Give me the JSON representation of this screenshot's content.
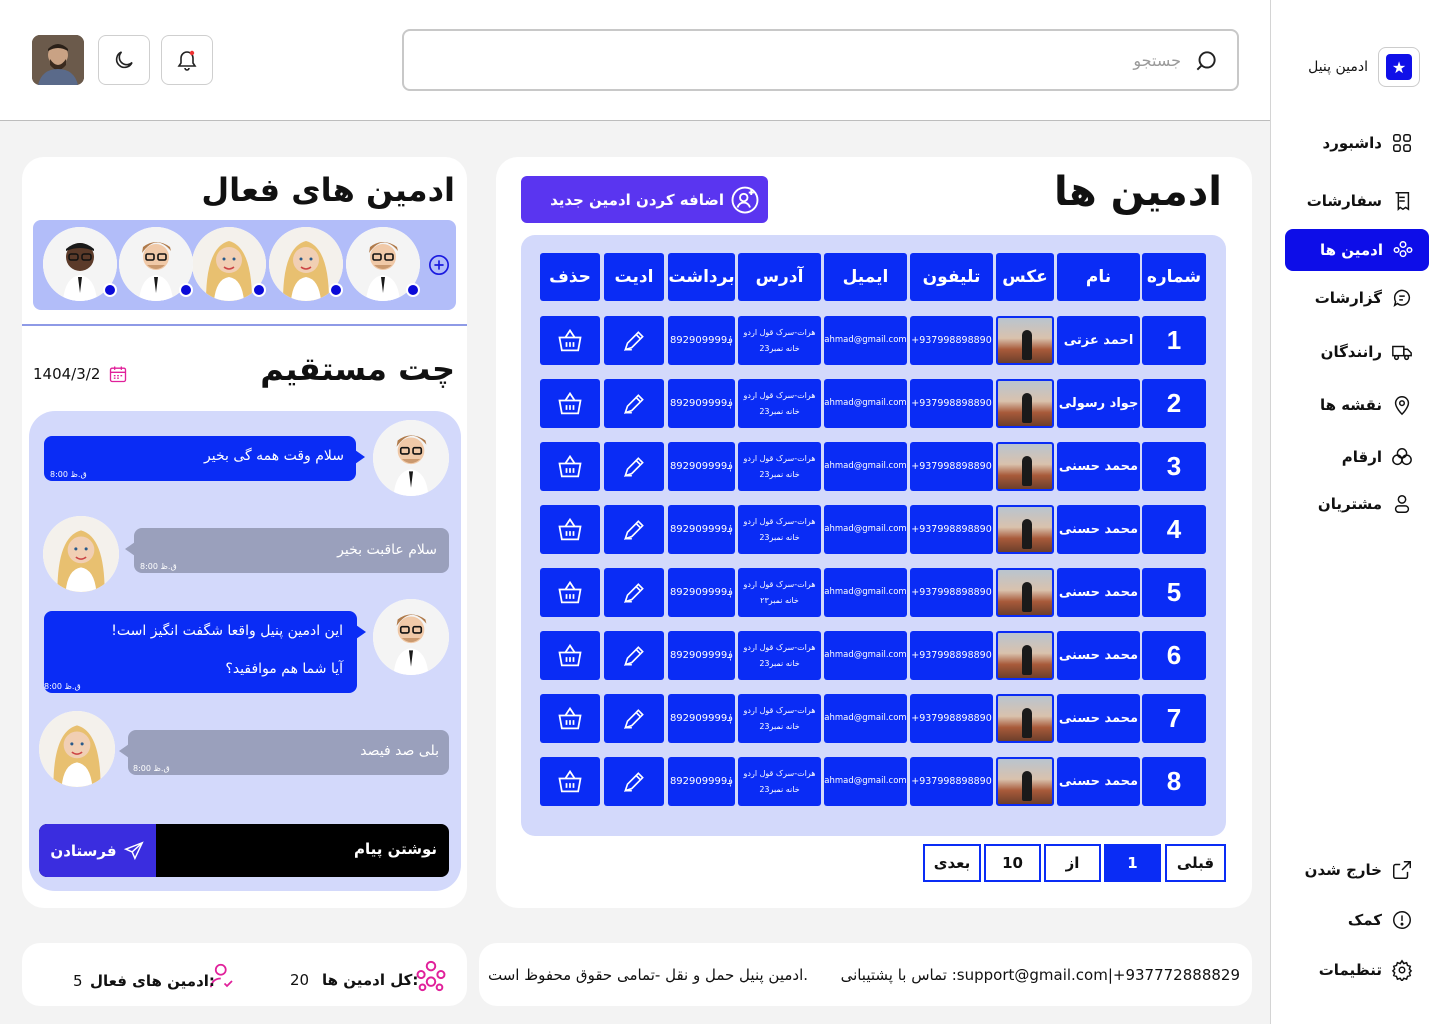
{
  "sidebar": {
    "brand": "ادمین پنیل",
    "nav": [
      {
        "label": "داشبورد",
        "icon": "grid-icon"
      },
      {
        "label": "سفارشات",
        "icon": "receipt-icon"
      },
      {
        "label": "ادمین ها",
        "icon": "users-icon",
        "active": true
      },
      {
        "label": "گزارشات",
        "icon": "chart-bubble-icon"
      },
      {
        "label": "رانندگان",
        "icon": "truck-icon"
      },
      {
        "label": "نقشه ها",
        "icon": "map-pin-icon"
      },
      {
        "label": "ارقام",
        "icon": "stats-icon"
      },
      {
        "label": "مشتریان",
        "icon": "user-icon"
      }
    ],
    "bottom": [
      {
        "label": "خارج شدن",
        "icon": "logout-icon"
      },
      {
        "label": "کمک",
        "icon": "help-icon"
      },
      {
        "label": "تنظیمات",
        "icon": "gear-icon"
      }
    ]
  },
  "header": {
    "search_placeholder": "جستجو"
  },
  "admins": {
    "title": "ادمین ها",
    "add_button": "اضافه کردن ادمین جدید",
    "columns": [
      "شماره",
      "نام",
      "عکس",
      "تلیفون",
      "ایمیل",
      "آدرس",
      "برداشت",
      "ادیت",
      "حذف"
    ],
    "rows": [
      {
        "num": "1",
        "name": "احمد عزتی",
        "phone": "+937998898890",
        "email": "ahmad@gmail.com",
        "addr1": "هرات-سرک قول اردو",
        "addr2": "خانه نمبر23",
        "withdraw": "892909999؋"
      },
      {
        "num": "2",
        "name": "جواد رسولی",
        "phone": "+937998898890",
        "email": "ahmad@gmail.com",
        "addr1": "هرات-سرک قول اردو",
        "addr2": "خانه نمبر23",
        "withdraw": "892909999؋"
      },
      {
        "num": "3",
        "name": "محمد حسنی",
        "phone": "+937998898890",
        "email": "ahmad@gmail.com",
        "addr1": "هرات-سرک قول اردو",
        "addr2": "خانه نمبر23",
        "withdraw": "892909999؋"
      },
      {
        "num": "4",
        "name": "محمد حسنی",
        "phone": "+937998898890",
        "email": "ahmad@gmail.com",
        "addr1": "هرات-سرک قول اردو",
        "addr2": "خانه نمبر23",
        "withdraw": "892909999؋"
      },
      {
        "num": "5",
        "name": "محمد حسنی",
        "phone": "+937998898890",
        "email": "ahmad@gmail.com",
        "addr1": "هرات-سرک قول اردو",
        "addr2": "خانه نمبر۲۳",
        "withdraw": "892909999؋"
      },
      {
        "num": "6",
        "name": "محمد حسنی",
        "phone": "+937998898890",
        "email": "ahmad@gmail.com",
        "addr1": "هرات-سرک قول اردو",
        "addr2": "خانه نمبر23",
        "withdraw": "892909999؋"
      },
      {
        "num": "7",
        "name": "محمد حسنی",
        "phone": "+937998898890",
        "email": "ahmad@gmail.com",
        "addr1": "هرات-سرک قول اردو",
        "addr2": "خانه نمبر23",
        "withdraw": "892909999؋"
      },
      {
        "num": "8",
        "name": "محمد حسنی",
        "phone": "+937998898890",
        "email": "ahmad@gmail.com",
        "addr1": "هرات-سرک قول اردو",
        "addr2": "خانه نمبر23",
        "withdraw": "892909999؋"
      }
    ],
    "pagination": {
      "prev": "قبلی",
      "current": "1",
      "of": "از",
      "total": "10",
      "next": "بعدی"
    }
  },
  "active_admins": {
    "title": "ادمین های فعال",
    "faces": [
      "man-glasses",
      "woman-blonde",
      "woman-blonde",
      "man-glasses",
      "man-dark"
    ]
  },
  "chat": {
    "title": "چت مستقیم",
    "date": "1404/3/2",
    "messages": [
      {
        "from": "me",
        "lines": [
          "سلام وقت همه گی بخیر"
        ],
        "time": "8:00 ق.ظ"
      },
      {
        "from": "them",
        "lines": [
          "سلام  عاقبت بخیر"
        ],
        "time": "8:00 ق.ظ"
      },
      {
        "from": "me",
        "lines": [
          "این ادمین پنیل واقعا شگفت انگیز است!",
          "آیا شما هم موافقید؟"
        ],
        "time": "8:00 ق.ظ"
      },
      {
        "from": "them",
        "lines": [
          "بلی صد فیصد"
        ],
        "time": "8:00 ق.ظ"
      }
    ],
    "input_placeholder": "نوشتن پیام",
    "send_label": "فرستادن"
  },
  "footer": {
    "contact": "تماس با پشتیبانی :support@gmail.com|+937772888829",
    "rights": "ادمین پنیل حمل و نقل -تمامی حقوق محفوظ است.",
    "total_label": "کل ادمین ها:",
    "total_value": "20",
    "active_label": "ادمین های فعال:",
    "active_value": "5"
  },
  "colors": {
    "primary": "#0a2cf5",
    "accent": "#5a35f0",
    "soft": "#d3d9fb"
  }
}
